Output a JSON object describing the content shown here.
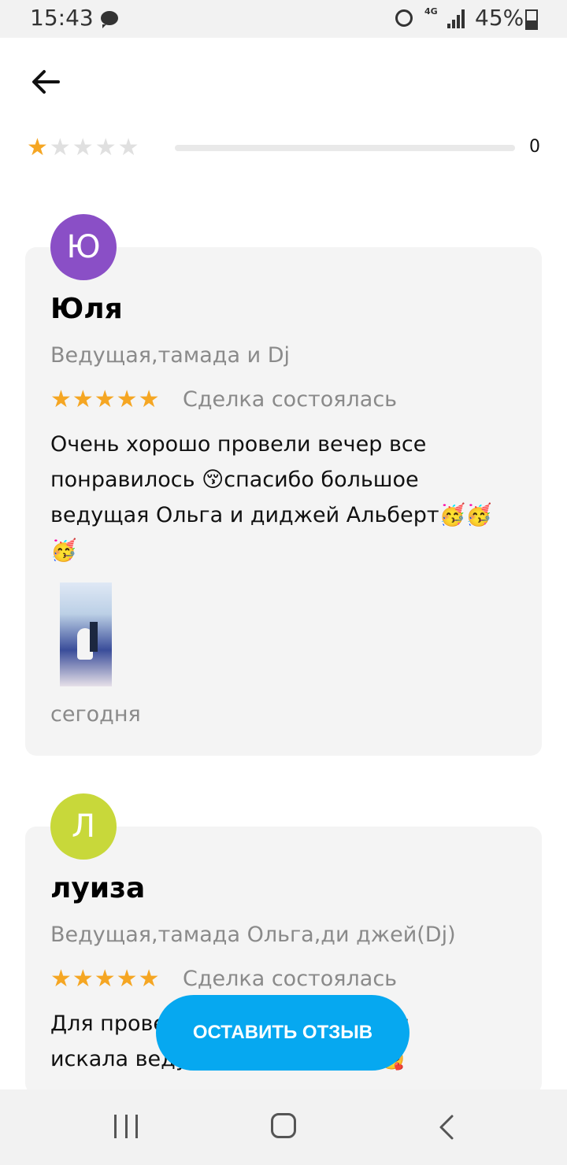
{
  "status_bar": {
    "time": "15:43",
    "network": "4G",
    "battery": "45%"
  },
  "rating_summary": {
    "stars_filled": 1,
    "stars_total": 5,
    "count": "0",
    "accent_color": "#f5a623"
  },
  "reviews": [
    {
      "avatar_letter": "Ю",
      "avatar_color": "#8a4fc6",
      "name": "Юля",
      "service": "Ведущая,тамада и Dj",
      "stars": "★★★★★",
      "status": "Сделка состоялась",
      "text_lines": [
        "Очень хорошо провели вечер все",
        "понравилось 😚спасибо большое",
        "ведущая Ольга и диджей Альберт🥳🥳",
        "🥳"
      ],
      "has_photo": true,
      "date": "сегодня"
    },
    {
      "avatar_letter": "Л",
      "avatar_color": "#c8d83a",
      "name": "луиза",
      "service": "Ведущая,тамада Ольга,ди джей(Dj)",
      "stars": "★★★★★",
      "status": "Сделка состоялась",
      "text_lines": [
        "Для проведения мероприятия я",
        "искала ведущую и нашла её 🥰"
      ]
    }
  ],
  "cta": {
    "label": "ОСТАВИТЬ ОТЗЫВ",
    "color": "#06a8f0"
  }
}
